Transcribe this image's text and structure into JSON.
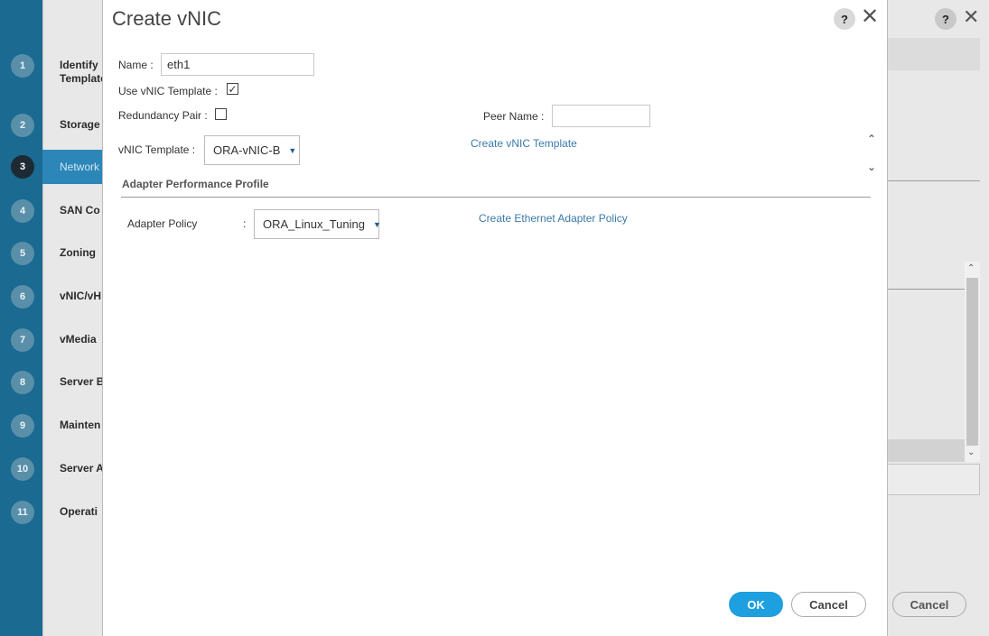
{
  "wizard": {
    "steps": [
      {
        "num": "1",
        "label": "Identify Template"
      },
      {
        "num": "2",
        "label": "Storage"
      },
      {
        "num": "3",
        "label": "Network"
      },
      {
        "num": "4",
        "label": "SAN Co"
      },
      {
        "num": "5",
        "label": "Zoning"
      },
      {
        "num": "6",
        "label": "vNIC/vH"
      },
      {
        "num": "7",
        "label": "vMedia"
      },
      {
        "num": "8",
        "label": "Server B"
      },
      {
        "num": "9",
        "label": "Mainten"
      },
      {
        "num": "10",
        "label": "Server A"
      },
      {
        "num": "11",
        "label": "Operati"
      }
    ],
    "help_label": "?",
    "cancel_label": "Cancel"
  },
  "modal": {
    "title": "Create vNIC",
    "help_label": "?",
    "close_label": "✕",
    "name_label": "Name :",
    "name_value": "eth1",
    "use_template_label": "Use vNIC Template :",
    "use_template_checked": true,
    "redundancy_label": "Redundancy Pair :",
    "redundancy_checked": false,
    "peer_name_label": "Peer Name :",
    "peer_name_value": "",
    "vnic_template_label": "vNIC Template :",
    "vnic_template_value": "ORA-vNIC-B",
    "create_template_link": "Create vNIC Template",
    "section_title": "Adapter Performance Profile",
    "adapter_policy_label": "Adapter Policy",
    "adapter_policy_colon": ":",
    "adapter_policy_value": "ORA_Linux_Tuning",
    "create_adapter_link": "Create Ethernet Adapter Policy",
    "ok_label": "OK",
    "cancel_label": "Cancel"
  }
}
